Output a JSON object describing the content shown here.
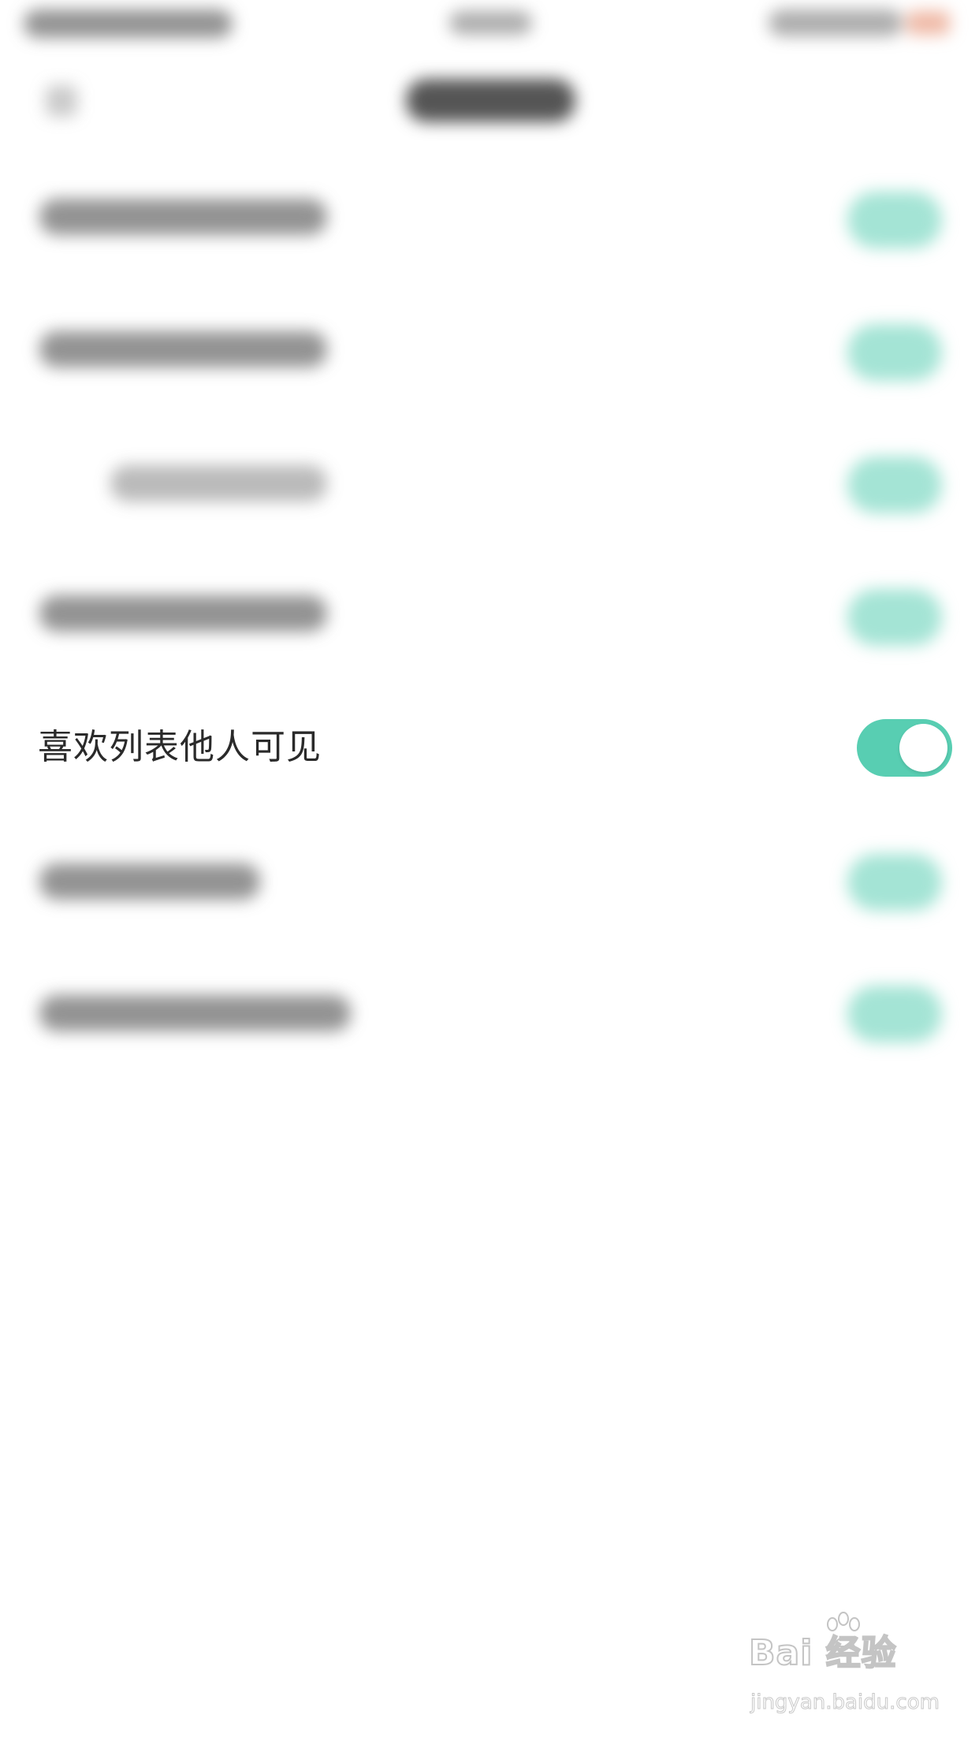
{
  "settings": {
    "focused_item": {
      "label": "喜欢列表他人可见",
      "toggle_state": "on"
    }
  },
  "watermark": {
    "brand": "Bai  经验",
    "url": "jingyan.baidu.com"
  },
  "colors": {
    "toggle_on": "#58ceb2",
    "text": "#2a2a2a",
    "background": "#ffffff"
  }
}
